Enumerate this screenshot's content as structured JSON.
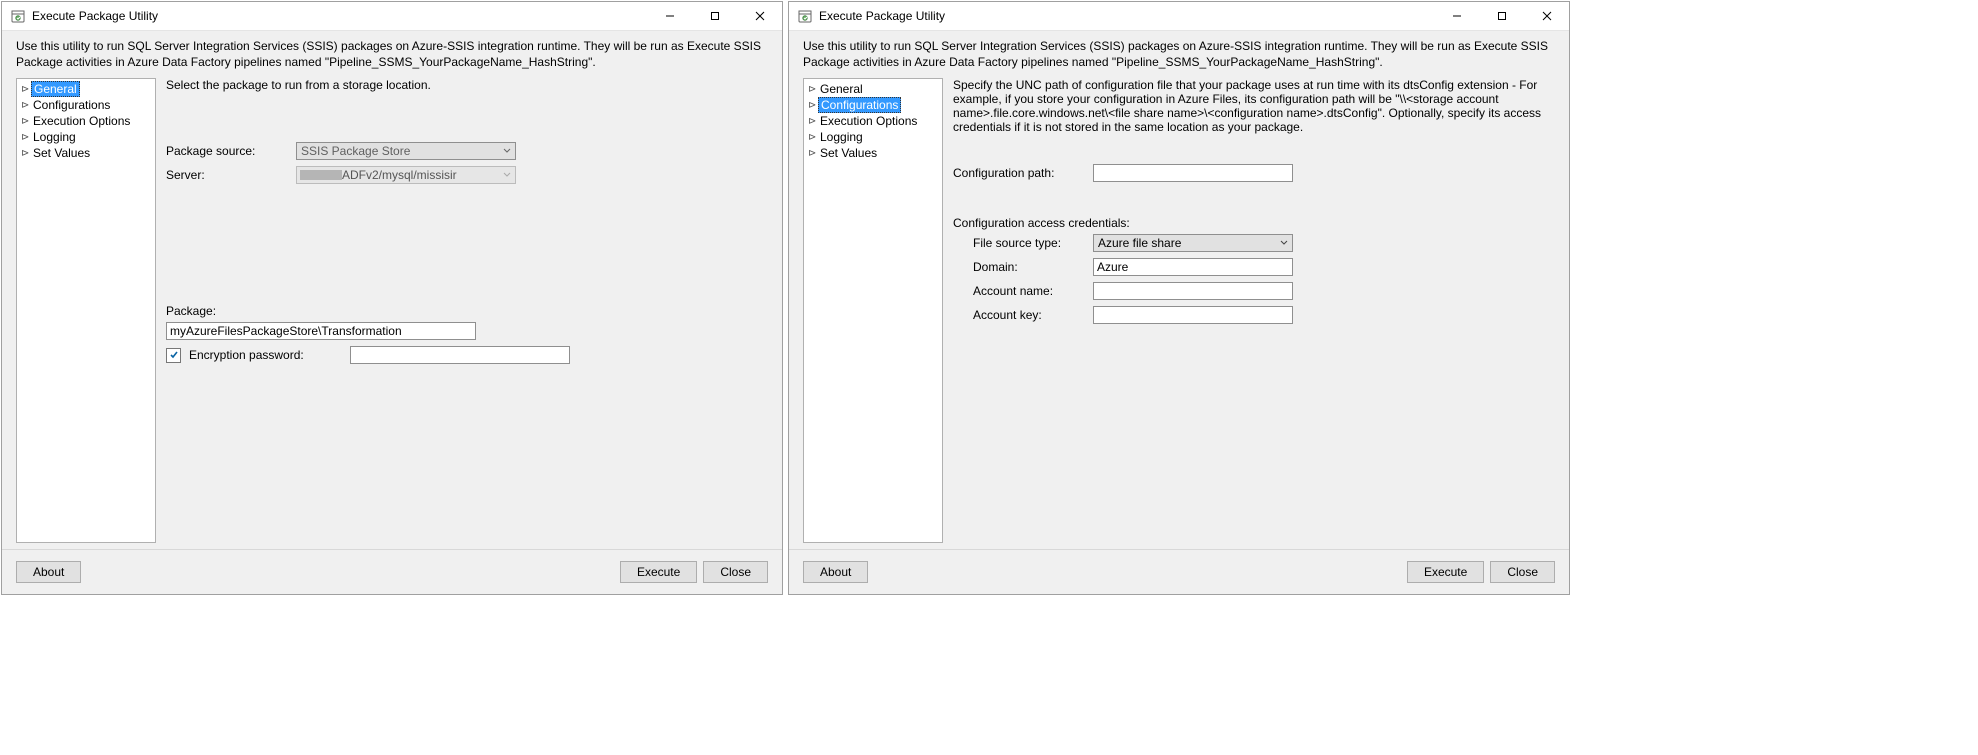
{
  "colors": {
    "highlight": "#3399ff"
  },
  "common": {
    "windowTitle": "Execute Package Utility",
    "introText": "Use this utility to run SQL Server Integration Services (SSIS) packages on Azure-SSIS integration runtime. They will be run as Execute SSIS Package activities in Azure Data Factory pipelines named \"Pipeline_SSMS_YourPackageName_HashString\".",
    "tree": {
      "items": [
        "General",
        "Configurations",
        "Execution Options",
        "Logging",
        "Set Values"
      ]
    },
    "buttons": {
      "about": "About",
      "execute": "Execute",
      "close": "Close"
    }
  },
  "left": {
    "selectedTreeIndex": 0,
    "desc": "Select the package to run from a storage location.",
    "labels": {
      "packageSource": "Package source:",
      "server": "Server:",
      "package": "Package:",
      "encryption": "Encryption password:"
    },
    "values": {
      "packageSource": "SSIS Package Store",
      "serverSuffix": "ADFv2/mysql/missisir",
      "package": "myAzureFilesPackageStore\\Transformation",
      "encryptionChecked": true,
      "encryptionPassword": ""
    }
  },
  "right": {
    "selectedTreeIndex": 1,
    "desc": "Specify the UNC path of configuration file that your package uses at run time with its dtsConfig extension - For example, if you store your configuration in Azure Files, its configuration path will be \"\\\\<storage account name>.file.core.windows.net\\<file share name>\\<configuration name>.dtsConfig\".  Optionally, specify its access credentials if it is not stored in the same location as your package.",
    "labels": {
      "configPath": "Configuration path:",
      "credHeading": "Configuration access credentials:",
      "fileSourceType": "File source type:",
      "domain": "Domain:",
      "accountName": "Account name:",
      "accountKey": "Account key:"
    },
    "values": {
      "configPath": "",
      "fileSourceType": "Azure file share",
      "domain": "Azure",
      "accountName": "",
      "accountKey": ""
    }
  }
}
